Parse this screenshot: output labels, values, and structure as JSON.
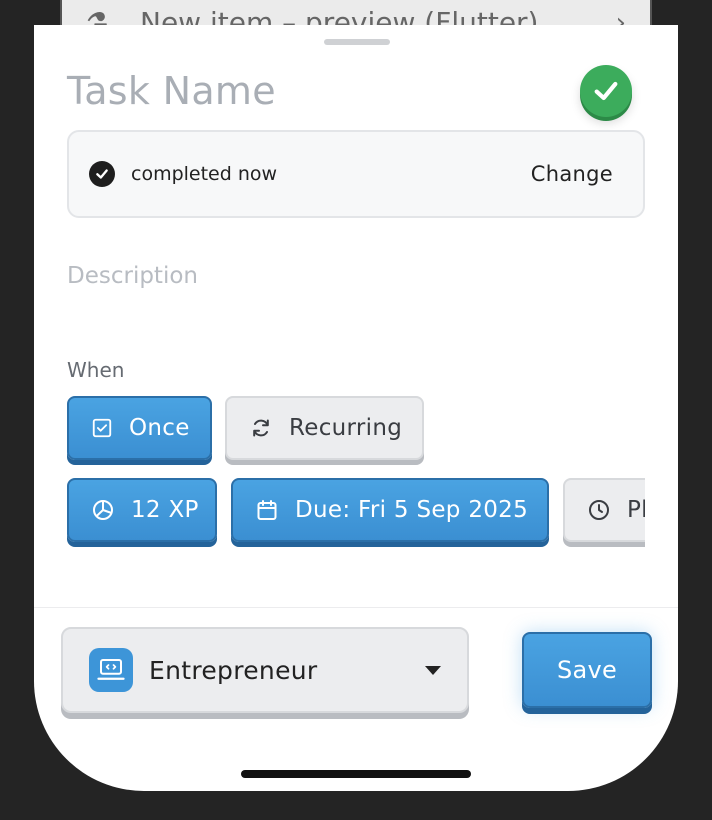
{
  "background_card": {
    "title": "New item – preview (Flutter)"
  },
  "task": {
    "name_placeholder": "Task Name"
  },
  "status": {
    "text": "completed now",
    "change_label": "Change"
  },
  "description": {
    "placeholder": "Description"
  },
  "when": {
    "label": "When",
    "options": [
      {
        "label": "Once",
        "icon": "checkbox-icon",
        "selected": true
      },
      {
        "label": "Recurring",
        "icon": "repeat-icon",
        "selected": false
      }
    ]
  },
  "chips": [
    {
      "label": "12 XP",
      "icon": "pie-icon",
      "style": "blue"
    },
    {
      "label": "Due: Fri 5 Sep 2025",
      "icon": "calendar-icon",
      "style": "blue"
    },
    {
      "label": "Pl",
      "icon": "clock-icon",
      "style": "grey"
    }
  ],
  "role": {
    "label": "Entrepreneur",
    "icon": "laptop-code-icon"
  },
  "save": {
    "label": "Save"
  },
  "colors": {
    "accent": "#3b8fd2",
    "success": "#3cac5c",
    "text": "#222222"
  }
}
